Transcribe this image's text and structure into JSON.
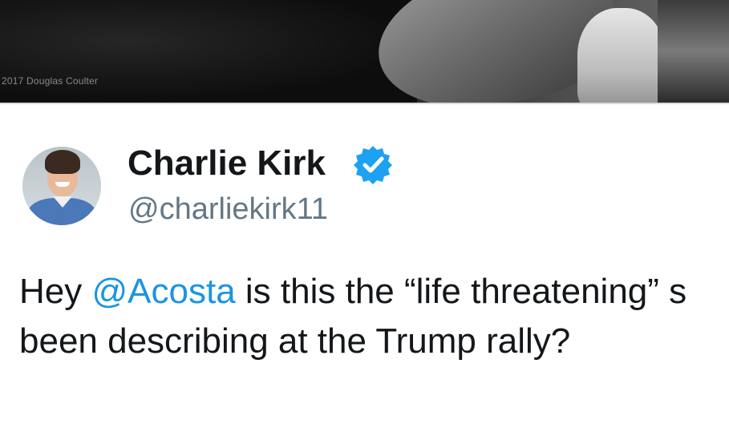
{
  "photo": {
    "credit": "2017 Douglas Coulter"
  },
  "tweet": {
    "author": {
      "name": "Charlie Kirk",
      "handle": "@charliekirk11",
      "verified": true,
      "avatar_icon": "profile-photo"
    },
    "text": {
      "line1_pre": "Hey ",
      "mention": "@Acosta",
      "line1_post": " is this the “life threatening” s",
      "line2": "been describing at the Trump rally?"
    }
  },
  "colors": {
    "text": "#14171a",
    "handle": "#657786",
    "mention": "#1b95e0",
    "verified_badge": "#1da1f2"
  }
}
